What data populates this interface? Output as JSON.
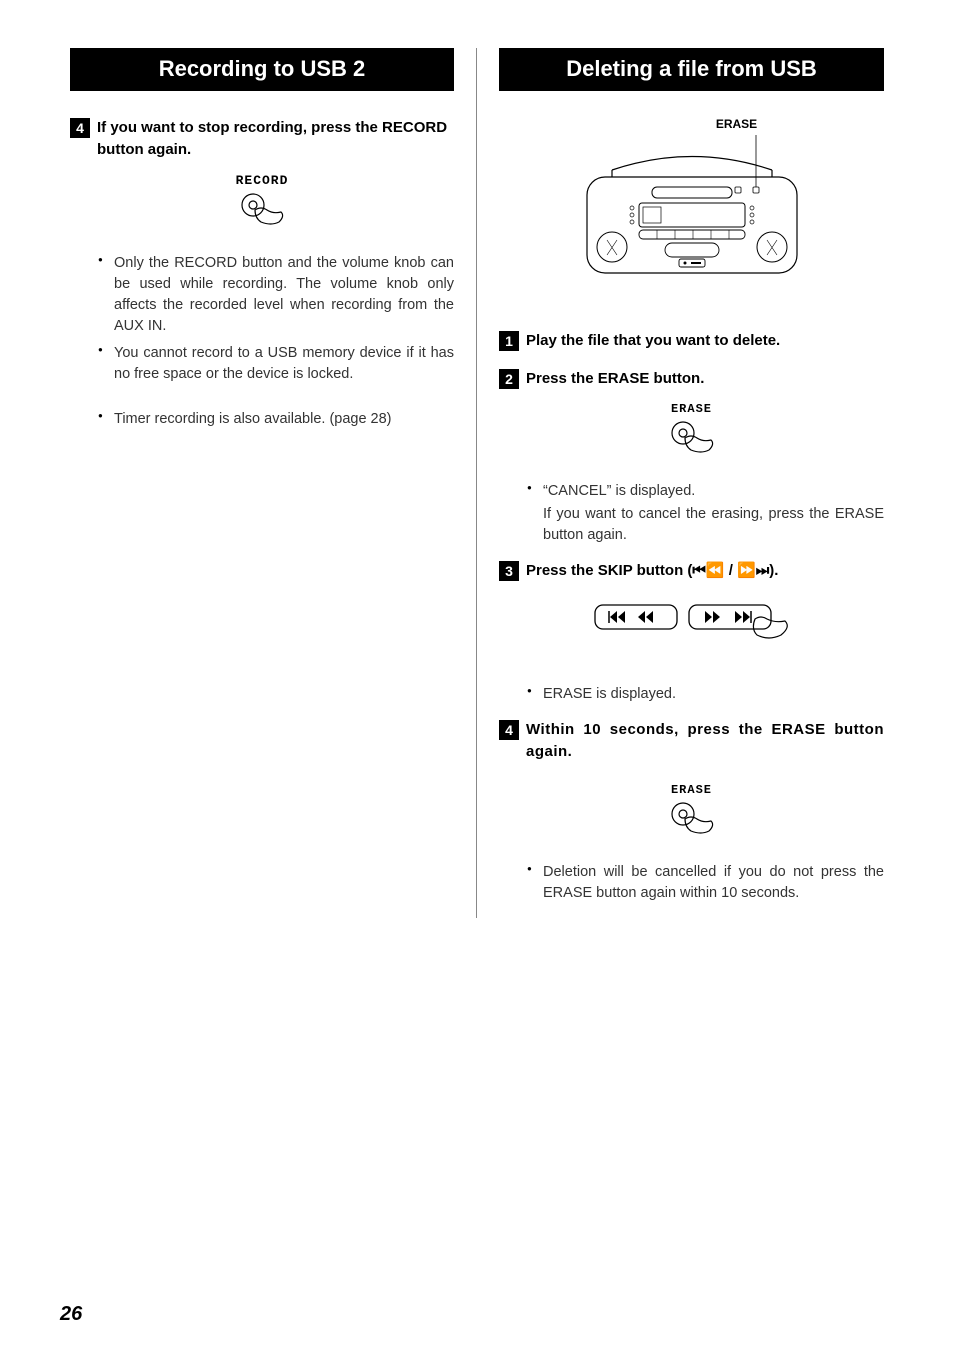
{
  "page_number": "26",
  "left": {
    "title": "Recording to USB 2",
    "step4_num": "4",
    "step4_text": "If you want to stop recording, press the RECORD button again.",
    "record_label": "RECORD",
    "bullets": [
      "Only the RECORD button and the volume knob can be used while recording. The volume knob only affects the recorded level when recording from the AUX IN.",
      "You cannot record to a USB memory device if it has no free space or the device is locked.",
      "Timer recording is also available. (page 28)"
    ]
  },
  "right": {
    "title": "Deleting a file from USB",
    "erase_top_label": "ERASE",
    "step1_num": "1",
    "step1_text": "Play the file that you want to delete.",
    "step2_num": "2",
    "step2_text": "Press the ERASE button.",
    "erase_label": "ERASE",
    "step2_bullet": "“CANCEL” is displayed.",
    "step2_sub": "If you want to cancel the erasing, press the ERASE button again.",
    "step3_num": "3",
    "step3_text": "Press the SKIP button (⏮⏪ / ⏩⏭).",
    "step3_bullet": "ERASE is displayed.",
    "step4_num": "4",
    "step4_text": "Within 10 seconds, press the ERASE button again.",
    "step4_bullet": "Deletion will be cancelled if you do not press the ERASE button again within 10 seconds."
  }
}
